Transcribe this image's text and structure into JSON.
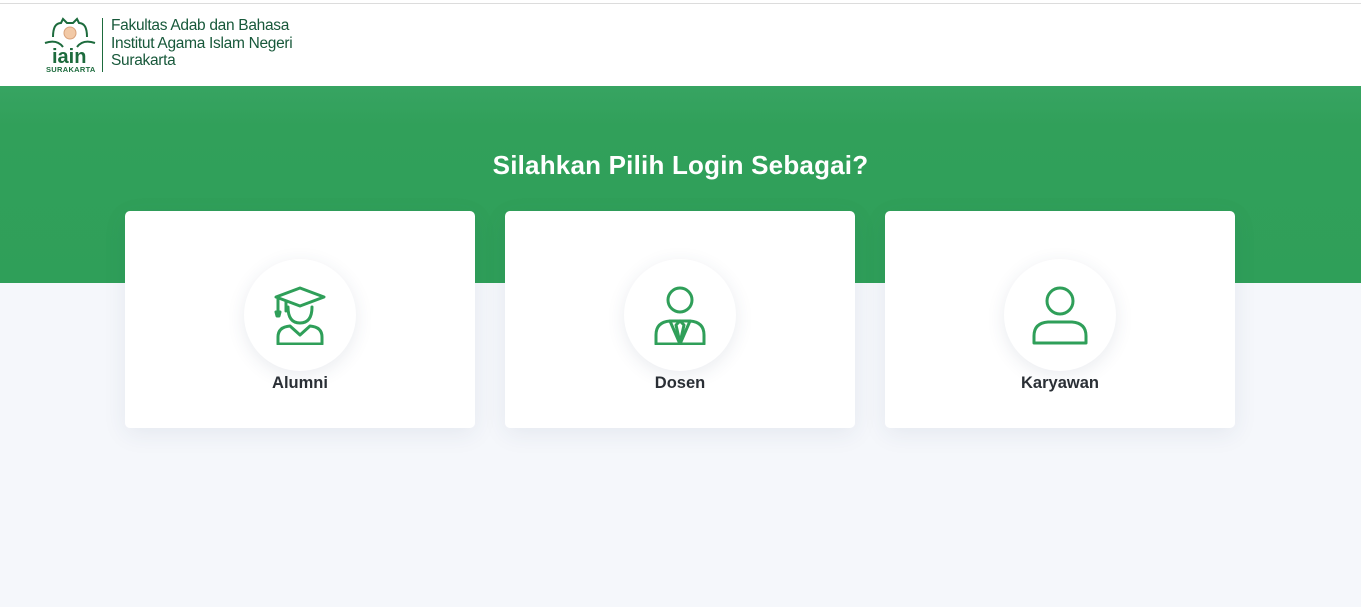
{
  "header": {
    "logo_caption": "SURAKARTA",
    "brand_lines": [
      "Fakultas Adab dan Bahasa",
      "Institut Agama Islam Negeri",
      "Surakarta"
    ]
  },
  "hero": {
    "title": "Silahkan Pilih Login Sebagai?"
  },
  "options": [
    {
      "label": "Alumni",
      "icon": "graduate-icon"
    },
    {
      "label": "Dosen",
      "icon": "lecturer-icon"
    },
    {
      "label": "Karyawan",
      "icon": "user-icon"
    }
  ],
  "colors": {
    "primary_green": "#2f9f59",
    "icon_green": "#2f9f59",
    "brand_green": "#17583a",
    "page_bg": "#f5f7fb"
  }
}
